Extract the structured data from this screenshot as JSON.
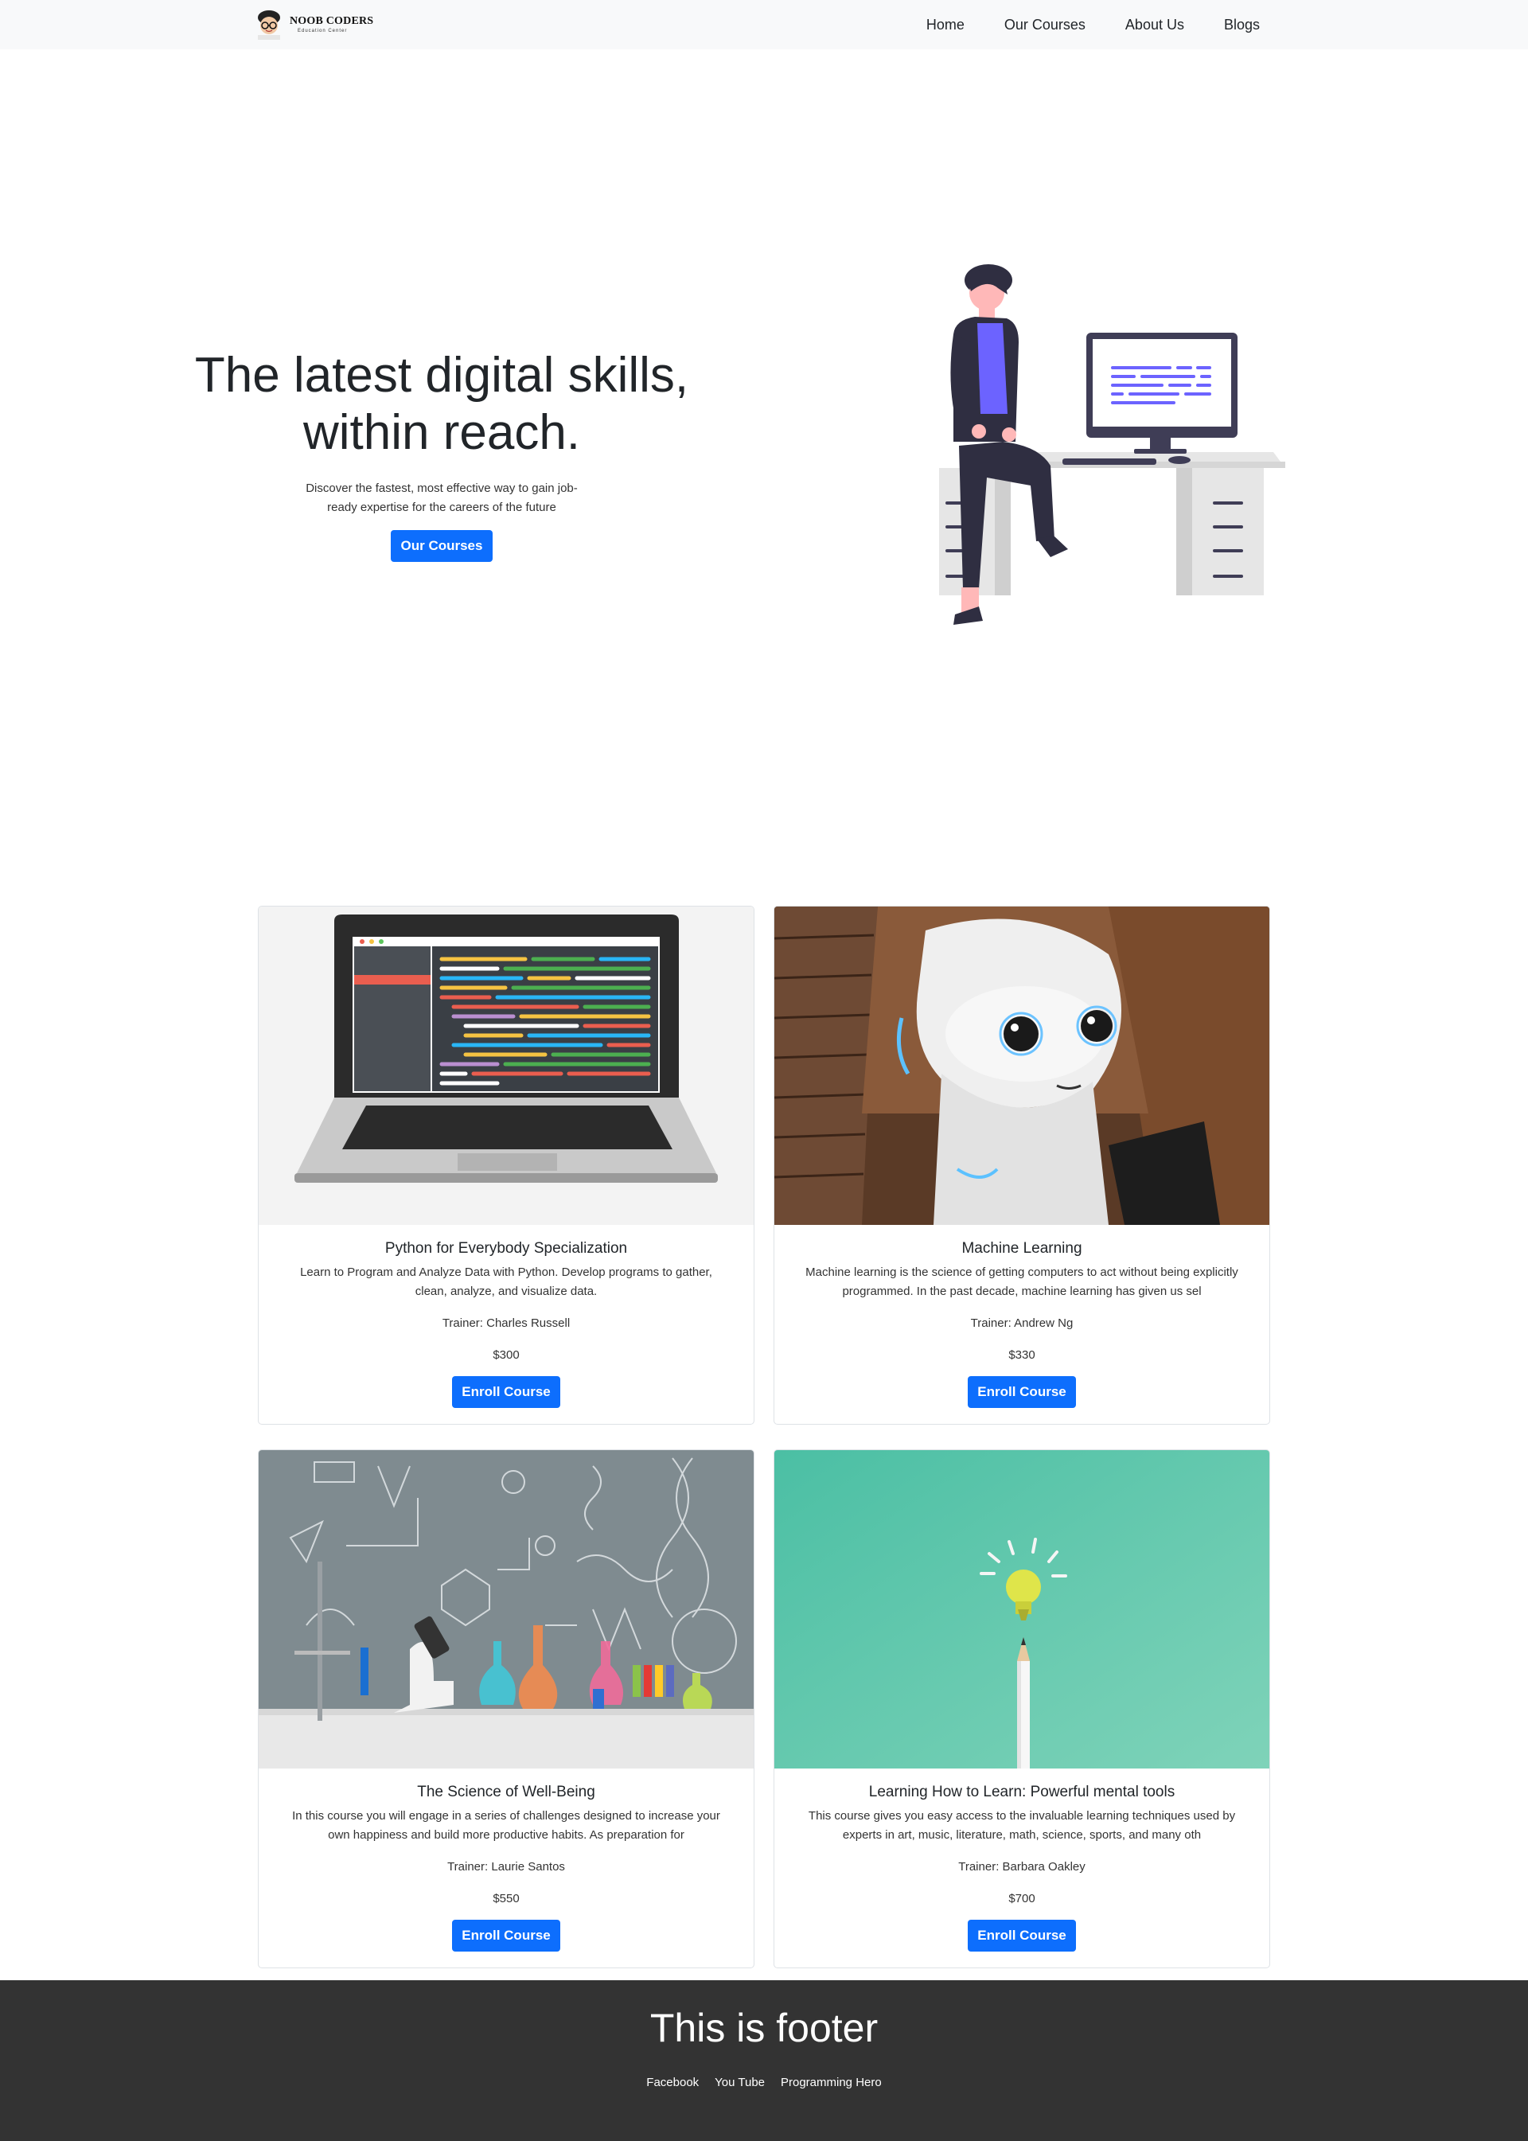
{
  "navbar": {
    "brand_name": "NOOB CODERS",
    "brand_sub": "Education Center",
    "links": [
      "Home",
      "Our Courses",
      "About Us",
      "Blogs"
    ]
  },
  "hero": {
    "title_line1": "The latest digital skills,",
    "title_line2": "within reach.",
    "description": "Discover the fastest, most effective way to gain job-ready expertise for the careers of the future",
    "button": "Our Courses"
  },
  "courses": [
    {
      "title": "Python for Everybody Specialization",
      "description": "Learn to Program and Analyze Data with Python. Develop programs to gather, clean, analyze, and visualize data.",
      "trainer": "Trainer: Charles Russell",
      "price": "$300",
      "button": "Enroll Course"
    },
    {
      "title": "Machine Learning",
      "description": "Machine learning is the science of getting computers to act without being explicitly programmed. In the past decade, machine learning has given us sel",
      "trainer": "Trainer: Andrew Ng",
      "price": "$330",
      "button": "Enroll Course"
    },
    {
      "title": "The Science of Well-Being",
      "description": "In this course you will engage in a series of challenges designed to increase your own happiness and build more productive habits. As preparation for",
      "trainer": "Trainer: Laurie Santos",
      "price": "$550",
      "button": "Enroll Course"
    },
    {
      "title": "Learning How to Learn: Powerful mental tools",
      "description": "This course gives you easy access to the invaluable learning techniques used by experts in art, music, literature, math, science, sports, and many oth",
      "trainer": "Trainer: Barbara Oakley",
      "price": "$700",
      "button": "Enroll Course"
    }
  ],
  "footer": {
    "title": "This is footer",
    "links": [
      "Facebook",
      "You Tube",
      "Programming Hero"
    ]
  },
  "colors": {
    "primary": "#0d6efd",
    "navbar_bg": "#f8f9fa",
    "footer_bg": "#333333",
    "accent_purple": "#6c63ff"
  },
  "icons": {
    "brand_logo": "nerd-face-logo-icon",
    "hero_illustration": "person-at-desk-illustration",
    "course_images": [
      "laptop-code-image",
      "robot-image",
      "science-lab-image",
      "lightbulb-pencil-image"
    ]
  }
}
